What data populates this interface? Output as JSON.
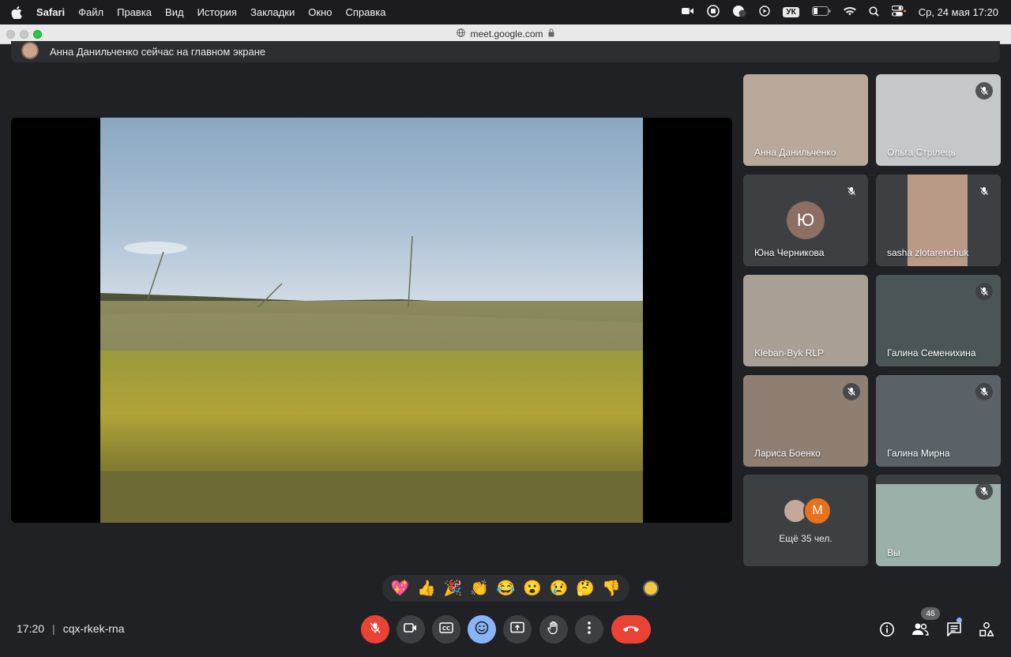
{
  "menubar": {
    "app_name": "Safari",
    "items": [
      "Файл",
      "Правка",
      "Вид",
      "История",
      "Закладки",
      "Окно",
      "Справка"
    ],
    "keyboard_layout": "УК",
    "clock": "Ср, 24 мая  17:20"
  },
  "browser": {
    "url": "meet.google.com"
  },
  "banner": {
    "text": "Анна Данильченко сейчас на главном экране"
  },
  "participants": [
    {
      "name": "Анна Данильченко",
      "muted": false
    },
    {
      "name": "Ольга Стрілець",
      "muted": true
    },
    {
      "name": "Юна Черникова",
      "muted": true,
      "initial": "Ю"
    },
    {
      "name": "sasha zlotarenchuk",
      "muted": true
    },
    {
      "name": "Kleban-Byk RLP",
      "muted": false
    },
    {
      "name": "Галина Семенихина",
      "muted": true
    },
    {
      "name": "Лариса Боенко",
      "muted": true
    },
    {
      "name": "Галина Мирна",
      "muted": true
    },
    {
      "name": "Вы",
      "muted": true
    }
  ],
  "more_tile": {
    "initial": "М",
    "text": "Ещё 35 чел."
  },
  "reactions": [
    "💖",
    "👍",
    "🎉",
    "👏",
    "😂",
    "😮",
    "😢",
    "🤔",
    "👎"
  ],
  "meeting": {
    "time": "17:20",
    "separator": "|",
    "code": "cqx-rkek-rna"
  },
  "people_count": "46",
  "colors": {
    "end_call": "#ea4335",
    "reactions_active": "#8ab4f8",
    "background": "#202124"
  }
}
